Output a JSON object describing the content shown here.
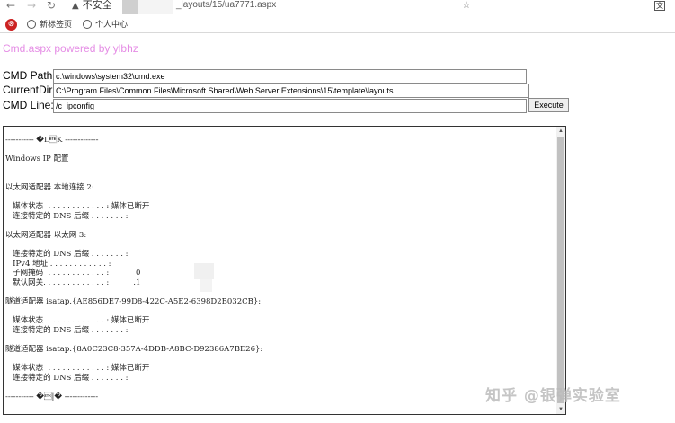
{
  "browser": {
    "security_label": "不安全",
    "url": "_layouts/15/ua7771.aspx",
    "icons": [
      "back-icon",
      "forward-icon",
      "reload-icon",
      "warning-icon",
      "star-icon",
      "translate-icon"
    ]
  },
  "bookmarks": {
    "items": [
      {
        "label": "新标签页",
        "icon": "globe-icon"
      },
      {
        "label": "个人中心",
        "icon": "globe-icon"
      }
    ]
  },
  "page": {
    "powered_by": "Cmd.aspx powered by ylbhz",
    "powered_color": "#e58de5",
    "cmd_path_label": "CMD Path:",
    "cmd_path_value": "c:\\windows\\system32\\cmd.exe",
    "current_dir_label": "CurrentDir:",
    "current_dir_value": "C:\\Program Files\\Common Files\\Microsoft Shared\\Web Server Extensions\\15\\template\\layouts",
    "cmd_line_label": "CMD Line:",
    "cmd_line_value": "/c  ipconfig",
    "execute_label": "Execute",
    "output": "----------- �L\u0017K -------------\n\nWindows IP 配置\n\n\n以太网适配器 本地连接 2:\n\n   媒体状态  . . . . . . . . . . . . : 媒体已断开\n   连接特定的 DNS 后缀 . . . . . . . :\n\n以太网适配器 以太网 3:\n\n   连接特定的 DNS 后缀 . . . . . . . :\n   IPv4 地址 . . . . . . . . . . . . :\n   子网掩码  . . . . . . . . . . . . :           0\n   默认网关. . . . . . . . . . . . . :          .1\n\n隧道适配器 isatap.{AE856DE7-99D8-422C-A5E2-6398D2B032CB}:\n\n   媒体状态  . . . . . . . . . . . . : 媒体已断开\n   连接特定的 DNS 后缀 . . . . . . . :\n\n隧道适配器 isatap.{8A0C23C8-357A-4DDB-A8BC-D92386A7BE26}:\n\n   媒体状态  . . . . . . . . . . . . : 媒体已断开\n   连接特定的 DNS 后缀 . . . . . . . :\n\n----------- �\u0002|� -------------"
  },
  "watermark": "知乎 @银弹实验室"
}
